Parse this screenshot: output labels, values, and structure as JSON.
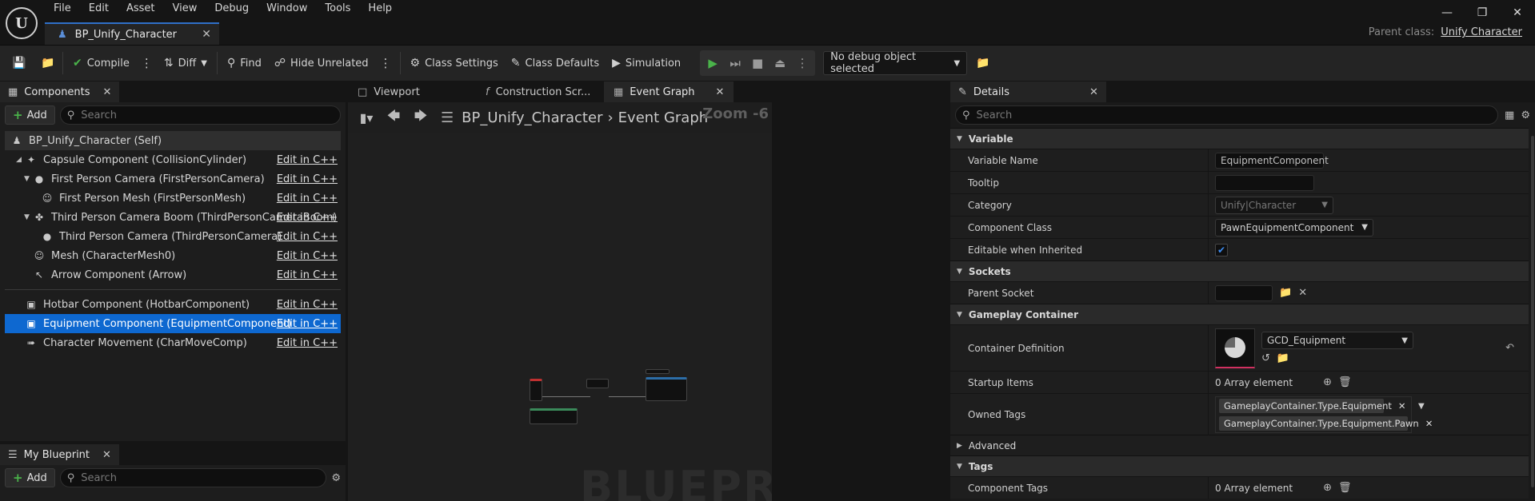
{
  "menu": [
    "File",
    "Edit",
    "Asset",
    "View",
    "Debug",
    "Window",
    "Tools",
    "Help"
  ],
  "doc_tab": {
    "label": "BP_Unify_Character"
  },
  "parent_class": {
    "label": "Parent class:",
    "value": "Unify Character"
  },
  "toolbar": {
    "compile": "Compile",
    "diff": "Diff",
    "find": "Find",
    "hide_unrelated": "Hide Unrelated",
    "class_settings": "Class Settings",
    "class_defaults": "Class Defaults",
    "simulation": "Simulation",
    "debug_object": "No debug object selected"
  },
  "components": {
    "tab": "Components",
    "add": "Add",
    "search_placeholder": "Search",
    "self": "BP_Unify_Character (Self)",
    "edit_label": "Edit in C++",
    "items": [
      {
        "label": "Capsule Component (CollisionCylinder)",
        "icon": "capsule-icon"
      },
      {
        "label": "First Person Camera (FirstPersonCamera)",
        "icon": "camera-icon"
      },
      {
        "label": "First Person Mesh (FirstPersonMesh)",
        "icon": "skeletal-mesh-icon"
      },
      {
        "label": "Third Person Camera Boom (ThirdPersonCameraBoom)",
        "icon": "spring-arm-icon"
      },
      {
        "label": "Third Person Camera (ThirdPersonCamera)",
        "icon": "camera-icon"
      },
      {
        "label": "Mesh (CharacterMesh0)",
        "icon": "skeletal-mesh-icon"
      },
      {
        "label": "Arrow Component (Arrow)",
        "icon": "arrow-icon"
      },
      {
        "label": "Hotbar Component (HotbarComponent)",
        "icon": "component-icon"
      },
      {
        "label": "Equipment Component (EquipmentComponent)",
        "icon": "component-icon"
      },
      {
        "label": "Character Movement (CharMoveComp)",
        "icon": "movement-icon"
      }
    ]
  },
  "my_blueprint": {
    "tab": "My Blueprint",
    "add": "Add",
    "search_placeholder": "Search"
  },
  "graph": {
    "tabs": [
      "Viewport",
      "Construction Scr...",
      "Event Graph"
    ],
    "breadcrumb_root": "BP_Unify_Character",
    "breadcrumb_current": "Event Graph",
    "zoom": "Zoom -6",
    "watermark": "BLUEPRINT"
  },
  "details": {
    "tab": "Details",
    "search_placeholder": "Search",
    "sections": {
      "variable": "Variable",
      "sockets": "Sockets",
      "gameplay_container": "Gameplay Container",
      "advanced": "Advanced",
      "tags": "Tags"
    },
    "props": {
      "variable_name": {
        "label": "Variable Name",
        "value": "EquipmentComponent"
      },
      "tooltip": {
        "label": "Tooltip",
        "value": ""
      },
      "category": {
        "label": "Category",
        "value": "Unify|Character"
      },
      "component_class": {
        "label": "Component Class",
        "value": "PawnEquipmentComponent"
      },
      "editable_inherited": {
        "label": "Editable when Inherited",
        "checked": true
      },
      "parent_socket": {
        "label": "Parent Socket",
        "value": ""
      },
      "container_definition": {
        "label": "Container Definition",
        "value": "GCD_Equipment"
      },
      "startup_items": {
        "label": "Startup Items",
        "value": "0 Array element"
      },
      "owned_tags": {
        "label": "Owned Tags",
        "tags": [
          "GameplayContainer.Type.Equipment",
          "GameplayContainer.Type.Equipment.Pawn"
        ]
      },
      "component_tags": {
        "label": "Component Tags",
        "value": "0 Array element"
      }
    }
  },
  "colors": {
    "accent": "#0e68d0",
    "play": "#4ab24a",
    "tab_highlight": "#2f6fc8"
  }
}
